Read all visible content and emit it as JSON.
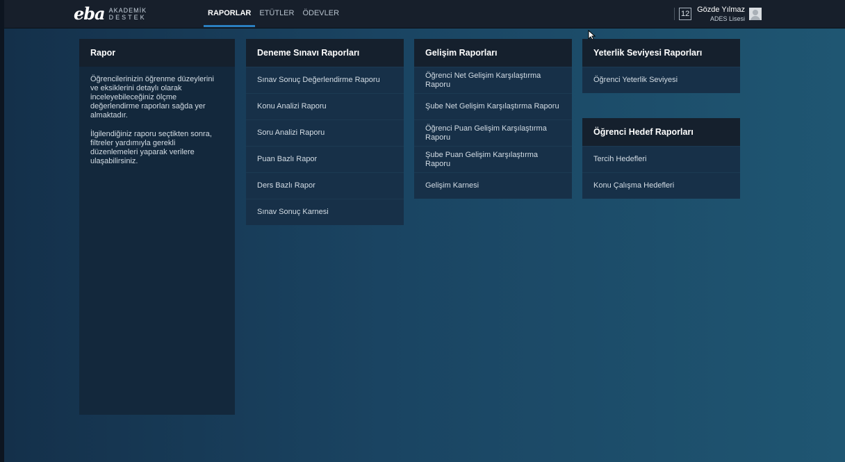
{
  "app": {
    "logo_mark": "eba",
    "logo_line1": "AKADEMİK",
    "logo_line2": "DESTEK"
  },
  "nav": {
    "items": [
      "RAPORLAR",
      "ETÜTLER",
      "ÖDEVLER"
    ],
    "active": "RAPORLAR"
  },
  "user": {
    "badge": "12",
    "name": "Gözde Yılmaz",
    "school": "ADES Lisesi"
  },
  "rapor": {
    "title": "Rapor",
    "paragraph1": "Öğrencilerinizin öğrenme düzeylerini ve eksiklerini detaylı olarak inceleyebileceğiniz ölçme değerlendirme raporları sağda yer almaktadır.",
    "paragraph2": "İlgilendiğiniz raporu seçtikten sonra, filtreler yardımıyla gerekli düzenlemeleri yaparak verilere ulaşabilirsiniz."
  },
  "deneme": {
    "title": "Deneme Sınavı Raporları",
    "items": [
      "Sınav Sonuç Değerlendirme Raporu",
      "Konu Analizi Raporu",
      "Soru Analizi Raporu",
      "Puan Bazlı Rapor",
      "Ders Bazlı Rapor",
      "Sınav Sonuç Karnesi"
    ]
  },
  "gelisim": {
    "title": "Gelişim Raporları",
    "items": [
      "Öğrenci Net Gelişim Karşılaştırma Raporu",
      "Şube Net Gelişim Karşılaştırma Raporu",
      "Öğrenci Puan Gelişim Karşılaştırma Raporu",
      "Şube Puan Gelişim Karşılaştırma Raporu",
      "Gelişim Karnesi"
    ]
  },
  "yeterlik": {
    "title": "Yeterlik Seviyesi Raporları",
    "items": [
      "Öğrenci Yeterlik Seviyesi"
    ]
  },
  "hedef": {
    "title": "Öğrenci Hedef Raporları",
    "items": [
      "Tercih Hedefleri",
      "Konu Çalışma Hedefleri"
    ]
  }
}
